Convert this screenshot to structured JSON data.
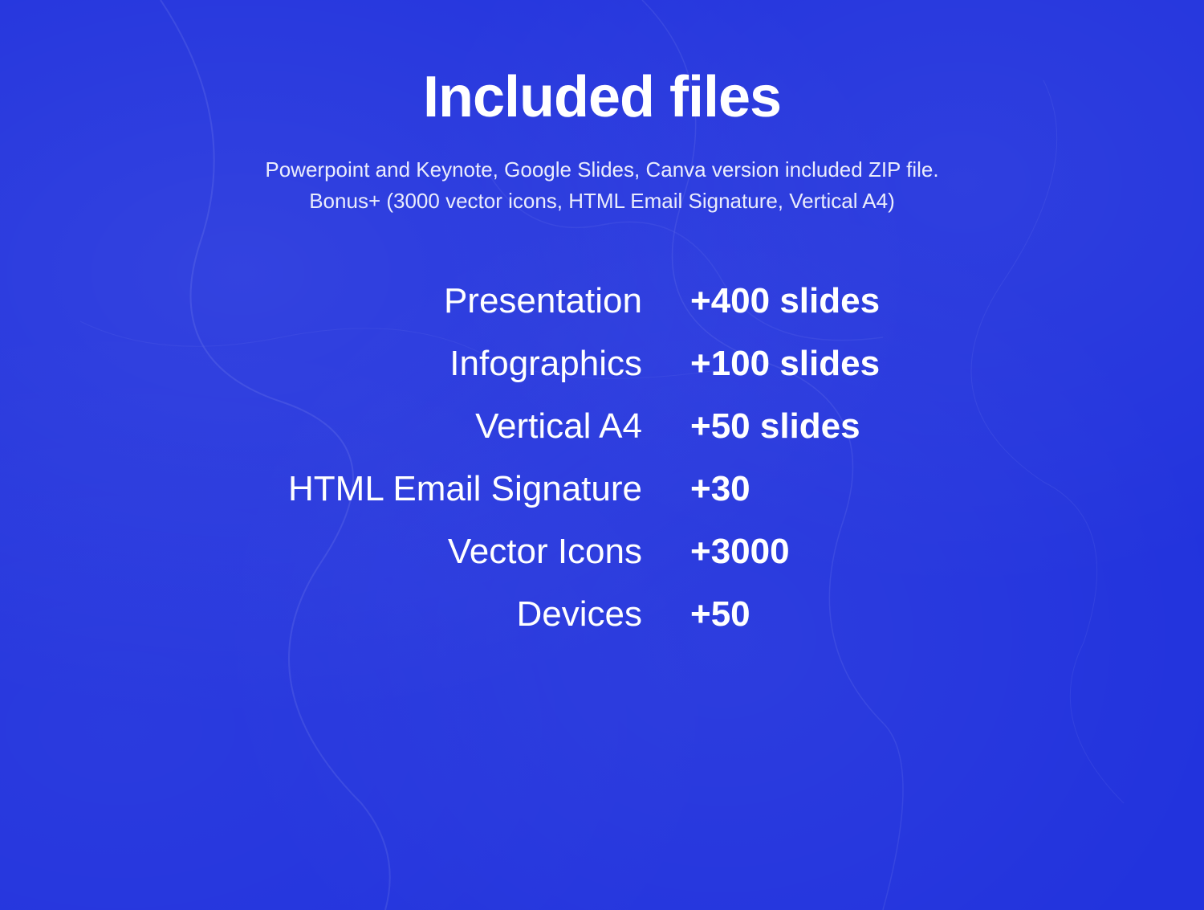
{
  "page": {
    "title": "Included files",
    "subtitle_line1": "Powerpoint and Keynote, Google Slides, Canva version included ZIP file.",
    "subtitle_line2": "Bonus+ (3000 vector icons, HTML Email Signature, Vertical A4)",
    "background_color": "#2233dd",
    "accent_color": "#ffffff"
  },
  "files": [
    {
      "label": "Presentation",
      "value": "+400 slides"
    },
    {
      "label": "Infographics",
      "value": "+100 slides"
    },
    {
      "label": "Vertical A4",
      "value": "+50 slides"
    },
    {
      "label": "HTML Email Signature",
      "value": "+30"
    },
    {
      "label": "Vector Icons",
      "value": "+3000"
    },
    {
      "label": "Devices",
      "value": "+50"
    }
  ]
}
